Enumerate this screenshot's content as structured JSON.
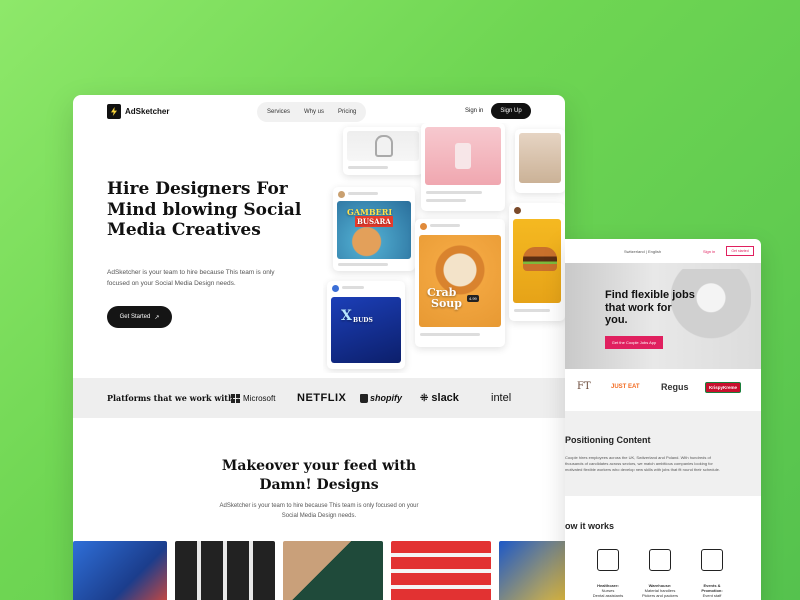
{
  "main": {
    "logo": "AdSketcher",
    "nav": [
      "Services",
      "Why us",
      "Pricing"
    ],
    "signin": "Sign in",
    "signup": "Sign Up",
    "hero_title": "Hire Designers For Mind blowing Social Media Creatives",
    "hero_sub": "AdSketcher is your team to hire because This team is only focused on your Social Media Design needs.",
    "cta": "Get Started",
    "cta_icon": "arrow-up-right-icon",
    "collage": {
      "food_words_1": [
        "GAMBERI",
        "BUSARA"
      ],
      "food_words_2": [
        "Crab",
        "Soup"
      ],
      "price": "4.99",
      "buds": "BUDS"
    },
    "platforms_label": "Platforms that we work with :",
    "brands": [
      "Microsoft",
      "NETFLIX",
      "shopify",
      "slack",
      "intel"
    ],
    "section_title": "Makeover your feed with Damn! Designs",
    "section_sub": "AdSketcher is your team to hire because This team is only focused on your Social Media Design needs."
  },
  "side": {
    "lang": "Switzerland | English",
    "signin": "Sign in",
    "btn": "Get started",
    "hero_title": "Find flexible jobs that work for you.",
    "hero_btn": "Get the Coople Jobs App",
    "logos": [
      "FT",
      "JUST EAT",
      "Regus",
      "KrispyKreme"
    ],
    "h2": "Positioning Content",
    "p": "Coople hires employees across the UK, Switzerland and Poland. With hundreds of thousands of candidates across sectors, we match ambitious companies looking for motivated flexible workers who develop new skills with jobs that fit round their schedule.",
    "how": "ow it works",
    "captions": [
      [
        "Healthcare:",
        "Nurses",
        "Dental assistants"
      ],
      [
        "Warehouse:",
        "Material handlers",
        "Pickers and packers"
      ],
      [
        "Events &",
        "Promotion:",
        "Event staff"
      ]
    ]
  },
  "colors": {
    "bg": "#6fd653",
    "accent": "#e0205f",
    "dark": "#111111"
  }
}
